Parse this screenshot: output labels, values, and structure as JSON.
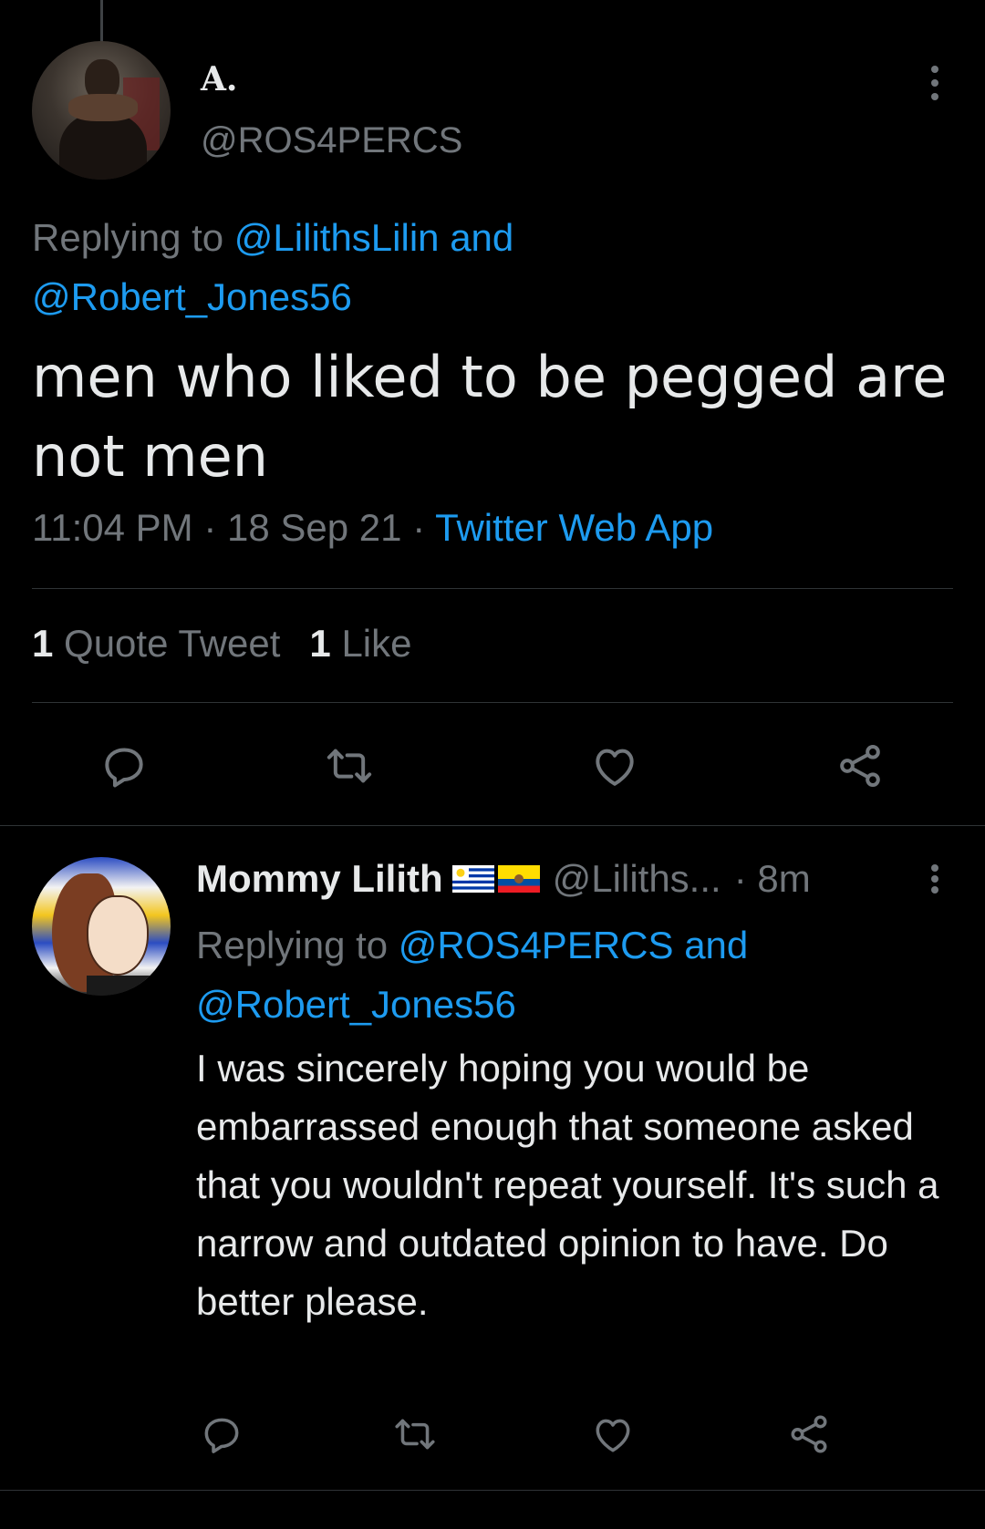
{
  "main_tweet": {
    "author_name": "A.",
    "author_handle": "@ROS4PERCS",
    "replying_prefix": "Replying to",
    "replying_mention_1": "@LilithsLilin",
    "replying_and": "and",
    "replying_mention_2": "@Robert_Jones56",
    "text": "men who liked to be pegged are not men",
    "time": "11:04 PM",
    "date": "18 Sep 21",
    "separator": "·",
    "source": "Twitter Web App",
    "quote_count": "1",
    "quote_label": "Quote Tweet",
    "like_count": "1",
    "like_label": "Like"
  },
  "reply_tweet": {
    "author_name": "Mommy Lilith",
    "flags": [
      "uruguay-flag-icon",
      "ecuador-flag-icon"
    ],
    "author_handle": "@Liliths...",
    "time_ago": "· 8m",
    "replying_prefix": "Replying to",
    "replying_mention_1": "@ROS4PERCS",
    "replying_and": "and",
    "replying_mention_2": "@Robert_Jones56",
    "text": "I was sincerely hoping you would be embarrassed enough that someone asked that you wouldn't repeat yourself. It's such a narrow and outdated opinion to have. Do better please."
  },
  "icons": {
    "reply": "reply-icon",
    "retweet": "retweet-icon",
    "like": "heart-icon",
    "share": "share-icon",
    "more": "more-icon"
  },
  "colors": {
    "background": "#000000",
    "text": "#e7e9ea",
    "secondary": "#71767b",
    "link": "#1d9bf0",
    "divider": "#2f3336"
  }
}
